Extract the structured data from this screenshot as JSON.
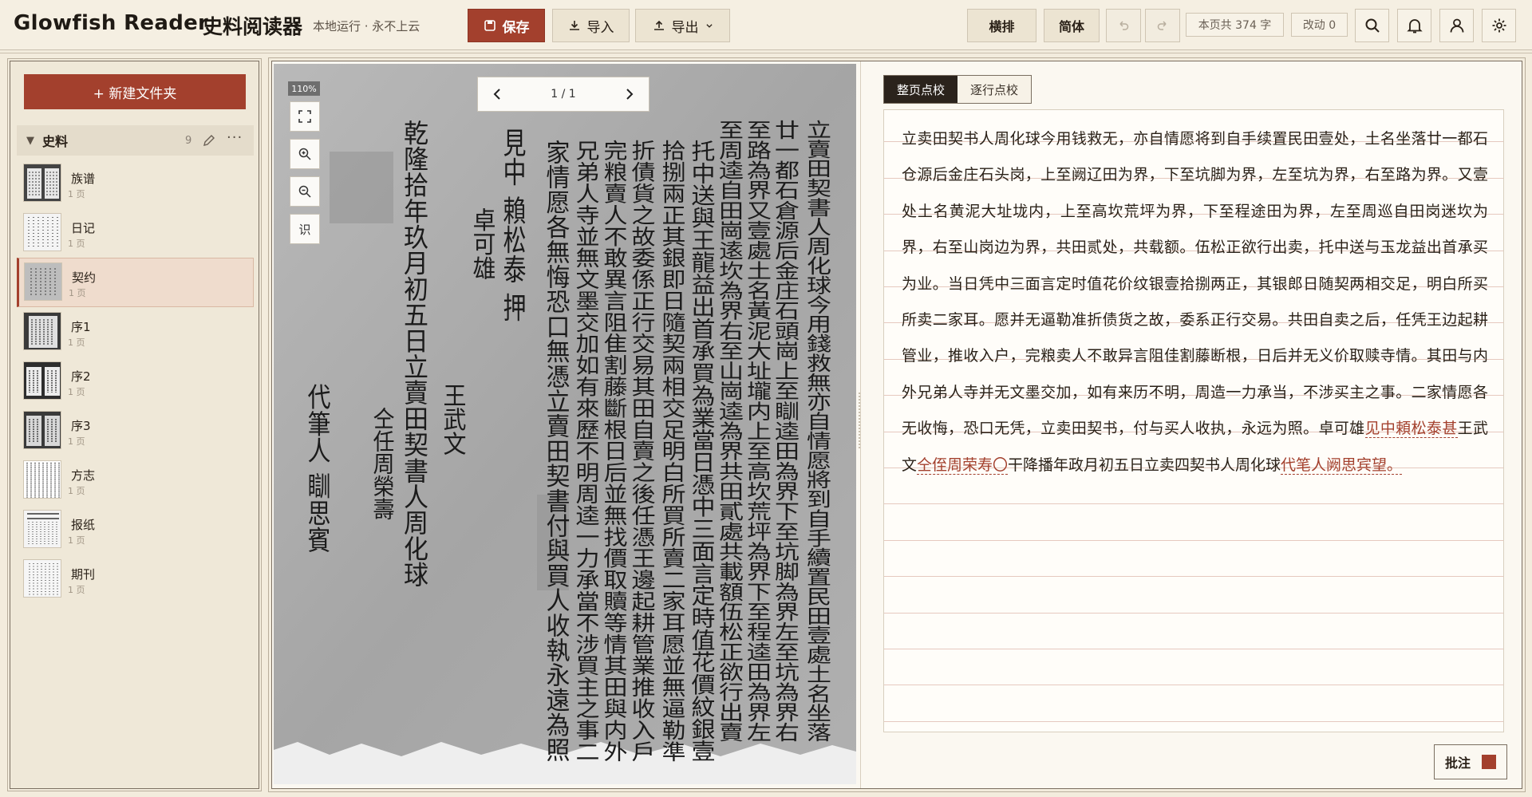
{
  "header": {
    "brand": "Glowfish Reader",
    "brand_sub": "史料阅读器",
    "tagline": "本地运行 · 永不上云",
    "save_label": "保存",
    "import_label": "导入",
    "export_label": "导出",
    "layout_label": "横排",
    "script_label": "简体",
    "char_count": "本页共 374 字",
    "change_count": "改动 0"
  },
  "sidebar": {
    "new_folder_label": "+ 新建文件夹",
    "group": {
      "name": "史料",
      "count": "9",
      "more": "···"
    },
    "items": [
      {
        "title": "族谱",
        "pages": "1 页"
      },
      {
        "title": "日记",
        "pages": "1 页"
      },
      {
        "title": "契约",
        "pages": "1 页"
      },
      {
        "title": "序1",
        "pages": "1 页"
      },
      {
        "title": "序2",
        "pages": "1 页"
      },
      {
        "title": "序3",
        "pages": "1 页"
      },
      {
        "title": "方志",
        "pages": "1 页"
      },
      {
        "title": "报纸",
        "pages": "1 页"
      },
      {
        "title": "期刊",
        "pages": "1 页"
      }
    ]
  },
  "viewer": {
    "zoom": "110%",
    "ocr_label": "识",
    "page_indicator": "1 / 1",
    "manuscript_columns": [
      "立賣田契書人周化球今用錢救無亦自情愿將到自手續置民田壹處土名坐落",
      "廿一都石倉源后金庄石頭崗上至瞓逵田為界下至坑脚為界左至坑為界右",
      "至路為界又壹處土名黃泥大址壠内上至高坎荒坪為界下至程逵田為界左",
      "至周逵自田崗逺坎為界右至山崗逵為界共田貳處共載額伍松正欲行出賣",
      "托中送與王龍益出首承買為業當日憑中三面言定時值花價紋銀壹",
      "拾捌兩正其銀即日隨契兩相交足明白所買所賣二家耳愿並無逼勒準",
      "折債貨之故委係正行交易其田自賣之後任憑王邊起耕管業推收入戶",
      "完粮賣人不敢異言阻隹割藤斷根日后並無找價取贖等情其田與内外",
      "兄弟人寺並無文墨交加如有來歷不明周逵一力承當不涉買主之事二",
      "家情愿各無悔恐口無憑立賣田契書付與買人收執永遠為照",
      "見中 賴松泰 押",
      "卓可雄",
      "王武文",
      "乾隆拾年玖月初五日立賣田契書人周化球",
      "仝任周榮壽",
      "代筆人 瞓思賓"
    ]
  },
  "editor": {
    "tab_whole": "整页点校",
    "tab_line": "逐行点校",
    "text_main": "立卖田契书人周化球今用钱救无，亦自情愿将到自手续置民田壹处，土名坐落廿一都石仓源后金庄石头岗，上至阙辽田为界，下至坑脚为界，左至坑为界，右至路为界。又壹处土名黄泥大址垅内，上至高坎荒坪为界，下至程途田为界，左至周巡自田岗迷坎为界，右至山岗边为界，共田贰处，共载额。伍松正欲行出卖，托中送与玉龙益出首承买为业。当日凭中三面言定时值花价纹银壹拾捌两正，其银郎日随契两相交足，明白所买所卖二家耳。愿并无逼勒准折债货之故，委系正行交易。共田自卖之后，任凭王边起耕管业，推收入户，完粮卖人不敢异言阻佳割藤断根，日后并无义价取赎寺情。其田与内外兄弟人寺并无文墨交加，如有来历不明，周造一力承当，不涉买主之事。二家情愿各无收悔，恐口无凭，立卖田契书，付与买人收执，永远为照。卓可雄",
    "anno1": "见中頼松泰甚",
    "text_mid1": "王武文",
    "anno2": "仝侄周荣寿〇",
    "text_mid2": "干降播年政月初五日立卖四契书人周化球",
    "anno3": "代笔人阙思宾望。",
    "anno_button": "批注"
  },
  "colors": {
    "accent": "#a3402d",
    "paper": "#f3ecdd",
    "dark_tab": "#2b231c"
  }
}
